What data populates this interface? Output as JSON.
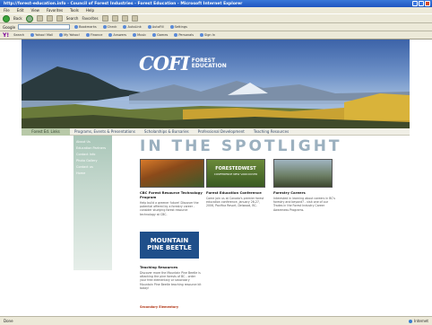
{
  "window": {
    "title": "http://forest-education.info - Council of Forest Industries - Forest Education - Microsoft Internet Explorer"
  },
  "menu": [
    "File",
    "Edit",
    "View",
    "Favorites",
    "Tools",
    "Help"
  ],
  "toolbar": {
    "back": "Back",
    "search": "Search",
    "favorites": "Favorites"
  },
  "address": {
    "label": "Google",
    "yahoo": "Y!",
    "search_label": "Search",
    "chips": [
      "Yahoo! Mail",
      "My Yahoo!",
      "Finance",
      "Answers",
      "Music",
      "Games",
      "Personals",
      "Sign In"
    ],
    "right_chips": [
      "Bookmarks",
      "Check",
      "AutoLink",
      "AutoFill",
      "Settings"
    ]
  },
  "banner": {
    "logo_mark": "COFI",
    "logo_line1": "FOREST",
    "logo_line2": "EDUCATION"
  },
  "nav": {
    "left": "Forest Ed. Links",
    "items": [
      "Programs, Events & Presentations",
      "Scholarships & Bursaries",
      "Professional Development",
      "Teaching Resources"
    ]
  },
  "sidebar": {
    "links": [
      "About Us",
      "Education Partners",
      "Contact Info",
      "Photo Gallery",
      "Contact us",
      "Home"
    ]
  },
  "spotlight": "IN THE SPOTLIGHT",
  "photos": {
    "forested_west": "FORESTEDWEST",
    "forested_west_sub": "CONFERENCE NEW VANCOUVER"
  },
  "columns": [
    {
      "title": "CBC Forest Resource Technology Program",
      "body": "Help build a greener future! Discover the potential offered by a forestry career - consider studying forest resource technology at CBC."
    },
    {
      "title": "Forest Education Conference",
      "body": "Come join us at Canada's premier forest education conference, January 26-27, 2006, Pacifica Resort, Delwood, BC."
    },
    {
      "title": "Forestry Careers",
      "body": "Interested in learning about careers in BC's forestry and beyond? - visit one of our Trades in the Forest Industry Career Awareness Programs."
    }
  ],
  "mpb": {
    "line1": "MOUNTAIN",
    "line2": "PINE BEETLE"
  },
  "teaching": {
    "title": "Teaching Resources",
    "body": "Discover more the Mountain Pine Beetle is attacking the pine forests of BC - order your free elementary or secondary Mountain Pine Beetle teaching resource kit today!"
  },
  "secondary_link": "Secondary  Elementary",
  "status": {
    "left": "Done",
    "zone": "Internet"
  }
}
